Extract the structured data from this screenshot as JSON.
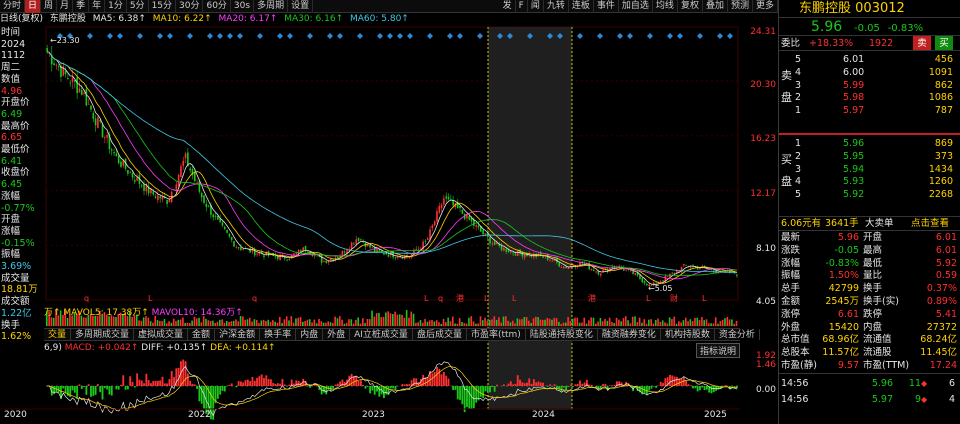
{
  "toolbar": {
    "items": [
      "分时",
      "日",
      "周",
      "月",
      "季",
      "年",
      "1分",
      "5分",
      "15分",
      "30分",
      "60分",
      "30s",
      "多周期",
      "设置"
    ],
    "right_items": [
      "发",
      "F",
      "闻",
      "九转",
      "连板",
      "事件",
      "加自选",
      "均线",
      "复权",
      "叠加",
      "预测",
      "更多"
    ]
  },
  "info": {
    "period": "日线(复权)",
    "stock_name": "东鹏控股",
    "ma5": "MA5: 6.38↑",
    "ma10": "MA10: 6.22↑",
    "ma20": "MA20: 6.17↑",
    "ma30": "MA30: 6.16↑",
    "ma60": "MA60: 5.80↑"
  },
  "left_panel": {
    "time_label": "时间",
    "year": "2024",
    "date": "1112",
    "weekday": "周二",
    "value_label": "数值",
    "value": "4.96",
    "open_label": "开盘价",
    "open": "6.49",
    "high_label": "最高价",
    "high": "6.65",
    "low_label": "最低价",
    "low": "6.41",
    "close_label": "收盘价",
    "close": "6.45",
    "chg_label": "涨幅",
    "chg": "-0.77%",
    "open_chg_label1": "开盘",
    "open_chg_label2": "涨幅",
    "open_chg": "-0.15%",
    "amp_label": "振幅",
    "amp": "3.69%",
    "vol_label": "成交量",
    "vol": "18.81万",
    "amt_label": "成交额",
    "amt": "1.22亿",
    "turn_label": "换手",
    "turn": "1.62%"
  },
  "price_axis": [
    "24.31",
    "20.30",
    "16.23",
    "12.17",
    "8.10",
    "4.05"
  ],
  "chart_data": {
    "type": "candlestick",
    "x": [
      "2020",
      "2022",
      "2023",
      "2024",
      "2025"
    ],
    "close_approx": [
      22.5,
      20.8,
      19.6,
      17.0,
      14.6,
      13.2,
      12.0,
      11.4,
      14.6,
      11.6,
      9.6,
      8.0,
      7.6,
      7.3,
      7.2,
      7.9,
      6.9,
      7.4,
      8.7,
      7.7,
      7.4,
      7.3,
      8.4,
      11.6,
      10.6,
      9.3,
      8.1,
      7.6,
      7.4,
      7.2,
      6.5,
      6.8,
      6.1,
      6.6,
      6.0,
      5.05,
      5.8,
      6.6,
      6.4,
      6.2,
      6.0
    ],
    "markers": {
      "high": "23.30",
      "low": "5.05"
    },
    "ylim": [
      4.05,
      24.31
    ]
  },
  "volume": {
    "label": "万↑",
    "mavol5": "MAVOL5: 17.38万↑",
    "mavol10": "MAVOL10: 14.36万↑"
  },
  "tabs": [
    "交量",
    "多周期成交量",
    "虚拟成交量",
    "金额",
    "沪深金额",
    "换手率",
    "内盘",
    "外盘",
    "AI立桩成交量",
    "盘后成交量",
    "市盈率(ttm)",
    "陆股通持股变化",
    "融资融券变化",
    "机构持股数",
    "资金分析"
  ],
  "indicator_button": "指标说明",
  "macd": {
    "params": "6,9)",
    "macd": "MACD: +0.042↑",
    "diff": "DIFF: +0.135↑",
    "dea": "DEA: +0.114↑"
  },
  "macd_axis": [
    "1.92",
    "1.46",
    "0.00"
  ],
  "years": [
    "2020",
    "2022",
    "2023",
    "2024",
    "2025"
  ],
  "panel": {
    "name": "东鹏控股",
    "code": "003012",
    "price": "5.96",
    "change": "-0.05",
    "pct": "-0.83%",
    "weibi_label": "委比",
    "weibi": "+18.33%",
    "weicha": "1922",
    "sell_btn": "卖",
    "buy_btn": "买",
    "sell_label": [
      "卖",
      "盘"
    ],
    "buy_label": [
      "买",
      "盘"
    ],
    "asks": [
      {
        "lvl": "5",
        "price": "6.01",
        "vol": "456"
      },
      {
        "lvl": "4",
        "price": "6.00",
        "vol": "1091"
      },
      {
        "lvl": "3",
        "price": "5.99",
        "vol": "862"
      },
      {
        "lvl": "2",
        "price": "5.98",
        "vol": "1086"
      },
      {
        "lvl": "1",
        "price": "5.97",
        "vol": "787"
      }
    ],
    "bids": [
      {
        "lvl": "1",
        "price": "5.96",
        "vol": "869"
      },
      {
        "lvl": "2",
        "price": "5.95",
        "vol": "373"
      },
      {
        "lvl": "3",
        "price": "5.94",
        "vol": "1434"
      },
      {
        "lvl": "4",
        "price": "5.93",
        "vol": "1260"
      },
      {
        "lvl": "5",
        "price": "5.92",
        "vol": "2268"
      }
    ],
    "big_order": {
      "amount": "6.06元有",
      "hands": "3641手",
      "type": "大卖单",
      "link": "点击查看"
    },
    "stats": [
      [
        "最新",
        "5.96",
        "开盘",
        "6.01"
      ],
      [
        "涨跌",
        "-0.05",
        "最高",
        "6.01"
      ],
      [
        "涨幅",
        "-0.83%",
        "最低",
        "5.92"
      ],
      [
        "振幅",
        "1.50%",
        "量比",
        "0.59"
      ],
      [
        "总手",
        "42799",
        "换手",
        "0.37%"
      ],
      [
        "金额",
        "2545万",
        "换手(实)",
        "0.89%"
      ],
      [
        "涨停",
        "6.61",
        "跌停",
        "5.41"
      ],
      [
        "外盘",
        "15420",
        "内盘",
        "27372"
      ],
      [
        "总市值",
        "68.96亿",
        "流通值",
        "68.24亿"
      ],
      [
        "总股本",
        "11.57亿",
        "流通股",
        "11.45亿"
      ],
      [
        "市盈(静)",
        "9.57",
        "市盈(TTM)",
        "17.24"
      ]
    ],
    "ticks": [
      {
        "time": "14:56",
        "price": "5.96",
        "vol": "11",
        "arrow": "◆",
        "count": "6"
      },
      {
        "time": "14:56",
        "price": "5.97",
        "vol": "9",
        "arrow": "◆",
        "count": "4"
      }
    ]
  },
  "colors": {
    "up": "#ff3030",
    "down": "#19c819",
    "ma5": "#e6e6e6",
    "ma10": "#ffd200",
    "ma20": "#ff3cff",
    "ma30": "#19c819",
    "ma60": "#3fc8e6"
  }
}
